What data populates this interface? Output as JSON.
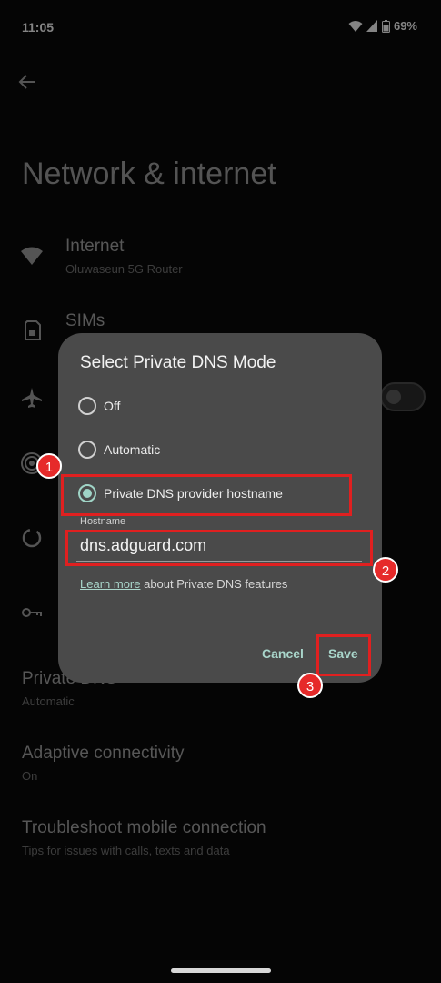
{
  "status": {
    "time": "11:05",
    "battery": "69%"
  },
  "page": {
    "title": "Network & internet"
  },
  "items": {
    "internet": {
      "title": "Internet",
      "subtitle": "Oluwaseun 5G Router"
    },
    "sims": {
      "title": "SIMs"
    },
    "private_dns": {
      "title": "Private DNS",
      "subtitle": "Automatic"
    },
    "adaptive": {
      "title": "Adaptive connectivity",
      "subtitle": "On"
    },
    "troubleshoot": {
      "title": "Troubleshoot mobile connection",
      "subtitle": "Tips for issues with calls, texts and data"
    }
  },
  "dialog": {
    "title": "Select Private DNS Mode",
    "options": [
      "Off",
      "Automatic",
      "Private DNS provider hostname"
    ],
    "selected": "Private DNS provider hostname",
    "hostname_label": "Hostname",
    "hostname_value": "dns.adguard.com",
    "learn_link": "Learn more",
    "learn_rest": " about Private DNS features",
    "cancel": "Cancel",
    "save": "Save"
  },
  "annotations": {
    "badge1": "1",
    "badge2": "2",
    "badge3": "3"
  },
  "colors": {
    "accent": "#a9d6cb",
    "annotation": "#e02020"
  }
}
